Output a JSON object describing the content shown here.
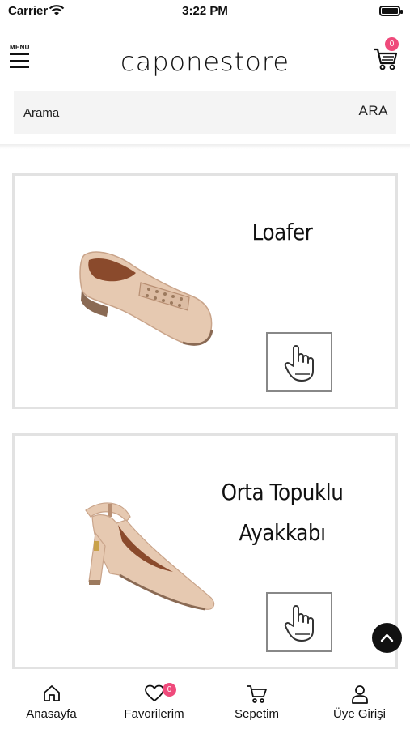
{
  "status_bar": {
    "carrier": "Carrier",
    "time": "3:22 PM"
  },
  "header": {
    "menu_label": "MENU",
    "logo_bold": "capone",
    "logo_light": "store",
    "cart_count": "0"
  },
  "search": {
    "placeholder": "Arama",
    "button_label": "ARA"
  },
  "categories": [
    {
      "title_line1": "Loafer",
      "title_line2": ""
    },
    {
      "title_line1": "Orta Topuklu",
      "title_line2": "Ayakkabı"
    }
  ],
  "bottom_nav": {
    "items": [
      {
        "label": "Anasayfa",
        "icon": "home-icon"
      },
      {
        "label": "Favorilerim",
        "icon": "heart-icon",
        "badge": "0"
      },
      {
        "label": "Sepetim",
        "icon": "cart-icon"
      },
      {
        "label": "Üye Girişi",
        "icon": "user-icon"
      }
    ]
  },
  "colors": {
    "badge": "#ef4a7b",
    "search_bg": "#f4f4f4",
    "card_border": "#e2e2e2",
    "shoe": "#e6c9b1"
  }
}
